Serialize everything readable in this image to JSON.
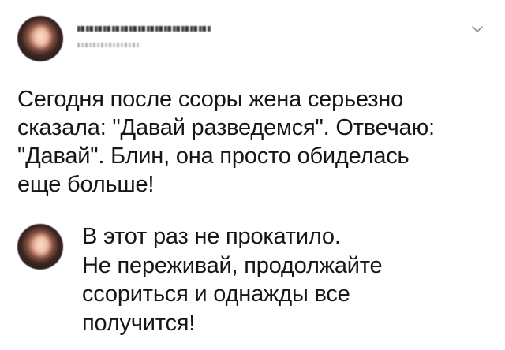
{
  "tweet": {
    "author_name": "",
    "author_handle": "",
    "text": "Сегодня после ссоры жена серьезно\nсказала: \"Давай разведемся\". Отвечаю:\n\"Давай\". Блин, она просто обиделась\nеще больше!"
  },
  "reply": {
    "text": "В этот раз не прокатило.\nНе переживай, продолжайте\nссориться и однажды все\nполучится!"
  },
  "icons": {
    "menu": "chevron-down-icon"
  },
  "colors": {
    "text": "#14171a",
    "divider": "#e1e8ed",
    "chevron": "#8899a6"
  }
}
